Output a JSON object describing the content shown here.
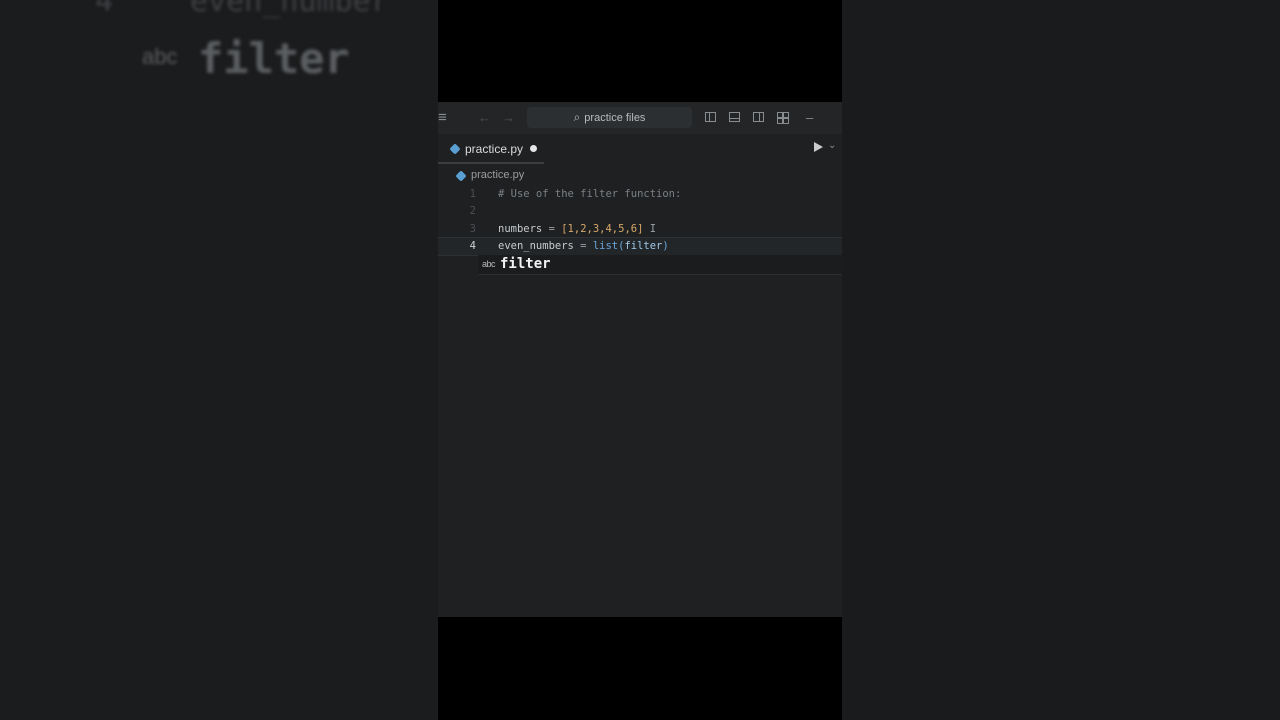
{
  "background": {
    "blur_line_number": "4",
    "blur_code_fragment": "even_number",
    "blur_kind": "abc",
    "blur_word": "filter"
  },
  "titlebar": {
    "menu_icon": "hamburger-icon",
    "back_icon": "arrow-left-icon",
    "forward_icon": "arrow-right-icon",
    "search_placeholder": "practice files",
    "layout_icons": [
      "sidebar-left-icon",
      "panel-bottom-icon",
      "sidebar-right-icon",
      "layout-grid-icon"
    ],
    "minimize_label": "–"
  },
  "tab": {
    "label": "practice.py",
    "modified": true
  },
  "breadcrumb": {
    "file": "practice.py"
  },
  "code": {
    "lines": [
      {
        "number": "1",
        "text": "# Use of the filter function:"
      },
      {
        "number": "2",
        "text": ""
      },
      {
        "number": "3",
        "text": "numbers = [1,2,3,4,5,6]"
      },
      {
        "number": "4",
        "text": "even_numbers = list(filter)"
      }
    ],
    "active_line": "4"
  },
  "suggestion": {
    "kind": "abc",
    "word": "filter"
  },
  "colors": {
    "accent": "#5a9fd4",
    "editor_bg": "#1e2022",
    "number": "#d9a86a",
    "function": "#6aa6d9"
  }
}
